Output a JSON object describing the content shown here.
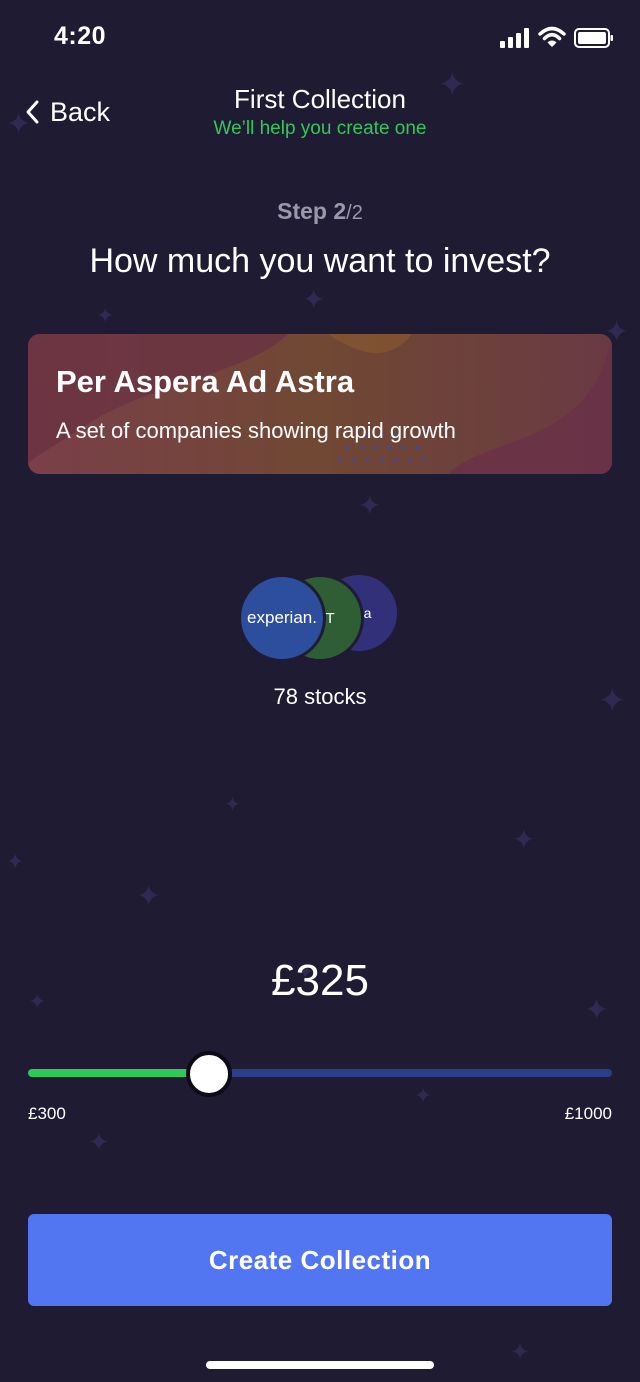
{
  "status_bar": {
    "time": "4:20"
  },
  "nav": {
    "back_label": "Back",
    "title": "First Collection",
    "subtitle": "We’ll help you create one"
  },
  "step": {
    "label": "Step 2",
    "total": "/2"
  },
  "question": "How much you want to invest?",
  "collection": {
    "title": "Per Aspera Ad Astra",
    "description": "A set of companies showing rapid growth",
    "logos": [
      {
        "name": "experian",
        "text": "experian."
      },
      {
        "name": "pratt",
        "text": "ATT"
      },
      {
        "name": "astrazeneca",
        "text": "neca"
      }
    ],
    "stock_count": "78 stocks"
  },
  "investment": {
    "amount": "£325",
    "slider_min_label": "£300",
    "slider_max_label": "£1000",
    "slider_value_fraction": 0.31
  },
  "actions": {
    "create_label": "Create Collection"
  },
  "colors": {
    "background": "#1f1b33",
    "accent_green": "#2fc95a",
    "button_blue": "#5275f2",
    "track_blue": "#2b3e8a"
  }
}
